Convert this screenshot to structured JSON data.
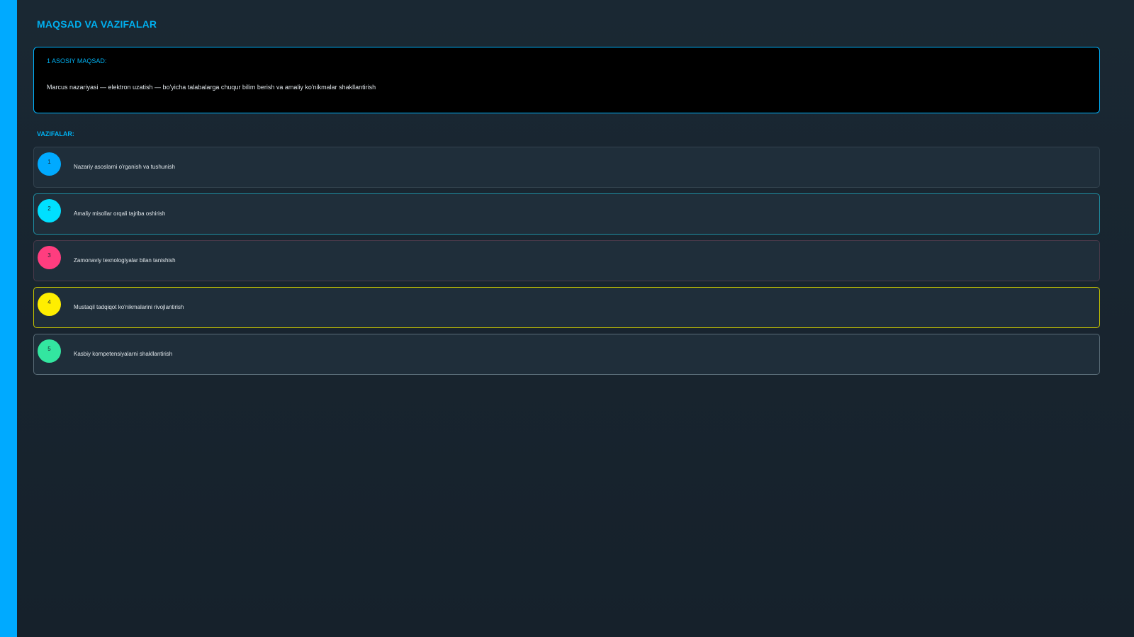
{
  "slide": {
    "title": "MAQSAD VA VAZIFALAR",
    "accent_color": "#00aaff"
  },
  "goal": {
    "label": "1 ASOSIY MAQSAD:",
    "text": "Marcus nazariyasi — elektron uzatish — bo'yicha talabalarga chuqur bilim berish va amaliy ko'nikmalar shakllantirish"
  },
  "tasks": {
    "heading": "VAZIFALAR:",
    "items": [
      {
        "number": "1",
        "text": "Nazariy asoslarni o'rganish va tushunish",
        "color": "#00aaff",
        "border": "#33434f"
      },
      {
        "number": "2",
        "text": "Amaliy misollar orqali tajriba oshirish",
        "color": "#00e0ff",
        "border": "#1f8fa3"
      },
      {
        "number": "3",
        "text": "Zamonaviy texnologiyalar bilan tanishish",
        "color": "#ff3d7f",
        "border": "#4a3a4a"
      },
      {
        "number": "4",
        "text": "Mustaqil tadqiqot ko'nikmalarini rivojlantirish",
        "color": "#ffee00",
        "border": "#c9c700"
      },
      {
        "number": "5",
        "text": "Kasbiy kompetensiyalarni shakllantirish",
        "color": "#33e6a0",
        "border": "#5a6d78"
      }
    ]
  }
}
